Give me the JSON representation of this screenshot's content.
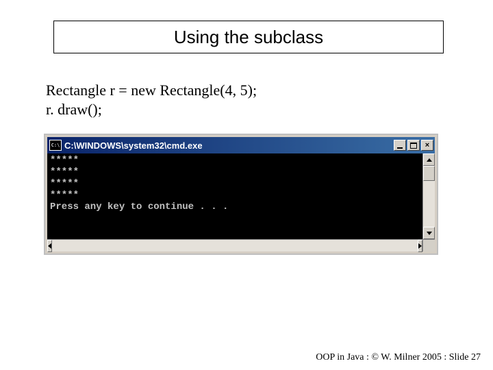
{
  "title": "Using the subclass",
  "code": {
    "line1": "Rectangle r = new Rectangle(4, 5);",
    "line2": "r. draw();"
  },
  "cmd": {
    "caption": "C:\\WINDOWS\\system32\\cmd.exe",
    "icon_glyph": "C:\\",
    "output": "*****\n*****\n*****\n*****\nPress any key to continue . . ."
  },
  "footer": "OOP in Java : © W. Milner 2005 : Slide 27"
}
